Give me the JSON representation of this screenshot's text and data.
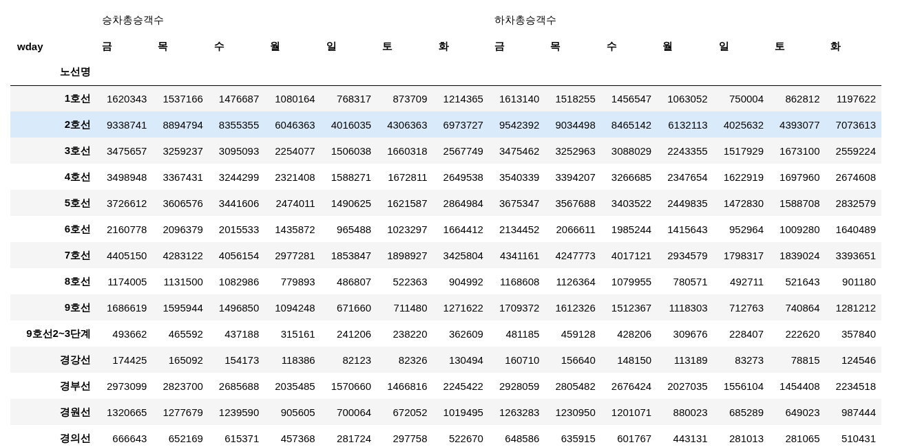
{
  "table": {
    "columns_name": "wday",
    "index_name": "노선명",
    "column_groups": [
      {
        "label": "승차총승객수",
        "columns": [
          "금",
          "목",
          "수",
          "월",
          "일",
          "토",
          "화"
        ]
      },
      {
        "label": "하차총승객수",
        "columns": [
          "금",
          "목",
          "수",
          "월",
          "일",
          "토",
          "화"
        ]
      }
    ],
    "rows": [
      {
        "label": "1호선",
        "selected": false,
        "values": [
          "1620343",
          "1537166",
          "1476687",
          "1080164",
          "768317",
          "873709",
          "1214365",
          "1613140",
          "1518255",
          "1456547",
          "1063052",
          "750004",
          "862812",
          "1197622"
        ]
      },
      {
        "label": "2호선",
        "selected": true,
        "values": [
          "9338741",
          "8894794",
          "8355355",
          "6046363",
          "4016035",
          "4306363",
          "6973727",
          "9542392",
          "9034498",
          "8465142",
          "6132113",
          "4025632",
          "4393077",
          "7073613"
        ]
      },
      {
        "label": "3호선",
        "selected": false,
        "values": [
          "3475657",
          "3259237",
          "3095093",
          "2254077",
          "1506038",
          "1660318",
          "2567749",
          "3475462",
          "3252963",
          "3088029",
          "2243355",
          "1517929",
          "1673100",
          "2559224"
        ]
      },
      {
        "label": "4호선",
        "selected": false,
        "values": [
          "3498948",
          "3367431",
          "3244299",
          "2321408",
          "1588271",
          "1672811",
          "2649538",
          "3540339",
          "3394207",
          "3266685",
          "2347654",
          "1622919",
          "1697960",
          "2674608"
        ]
      },
      {
        "label": "5호선",
        "selected": false,
        "values": [
          "3726612",
          "3606576",
          "3441606",
          "2474011",
          "1490625",
          "1621587",
          "2864984",
          "3675347",
          "3567688",
          "3403522",
          "2449835",
          "1472830",
          "1588708",
          "2832579"
        ]
      },
      {
        "label": "6호선",
        "selected": false,
        "values": [
          "2160778",
          "2096379",
          "2015533",
          "1435872",
          "965488",
          "1023297",
          "1664412",
          "2134452",
          "2066611",
          "1985244",
          "1415643",
          "952964",
          "1009280",
          "1640489"
        ]
      },
      {
        "label": "7호선",
        "selected": false,
        "values": [
          "4405150",
          "4283122",
          "4056154",
          "2977281",
          "1853847",
          "1898927",
          "3425804",
          "4341161",
          "4247773",
          "4017121",
          "2934579",
          "1798317",
          "1839024",
          "3393651"
        ]
      },
      {
        "label": "8호선",
        "selected": false,
        "values": [
          "1174005",
          "1131500",
          "1082986",
          "779893",
          "486807",
          "522363",
          "904992",
          "1168608",
          "1126364",
          "1079955",
          "780571",
          "492711",
          "521643",
          "901180"
        ]
      },
      {
        "label": "9호선",
        "selected": false,
        "values": [
          "1686619",
          "1595944",
          "1496850",
          "1094248",
          "671660",
          "711480",
          "1271622",
          "1709372",
          "1612326",
          "1512367",
          "1118303",
          "712763",
          "740864",
          "1281212"
        ]
      },
      {
        "label": "9호선2~3단계",
        "selected": false,
        "values": [
          "493662",
          "465592",
          "437188",
          "315161",
          "241206",
          "238220",
          "362609",
          "481185",
          "459128",
          "428206",
          "309676",
          "228407",
          "222620",
          "357840"
        ]
      },
      {
        "label": "경강선",
        "selected": false,
        "values": [
          "174425",
          "165092",
          "154173",
          "118386",
          "82123",
          "82326",
          "130494",
          "160710",
          "156640",
          "148150",
          "113189",
          "83273",
          "78815",
          "124546"
        ]
      },
      {
        "label": "경부선",
        "selected": false,
        "values": [
          "2973099",
          "2823700",
          "2685688",
          "2035485",
          "1570660",
          "1466816",
          "2245422",
          "2928059",
          "2805482",
          "2676424",
          "2027035",
          "1556104",
          "1454408",
          "2234518"
        ]
      },
      {
        "label": "경원선",
        "selected": false,
        "values": [
          "1320665",
          "1277679",
          "1239590",
          "905605",
          "700064",
          "672052",
          "1019495",
          "1263283",
          "1230950",
          "1201071",
          "880023",
          "685289",
          "649023",
          "987444"
        ]
      },
      {
        "label": "경의선",
        "selected": false,
        "values": [
          "666643",
          "652169",
          "615371",
          "457368",
          "281724",
          "297758",
          "522670",
          "648586",
          "635915",
          "601767",
          "443131",
          "281013",
          "281065",
          "510431"
        ]
      }
    ]
  }
}
